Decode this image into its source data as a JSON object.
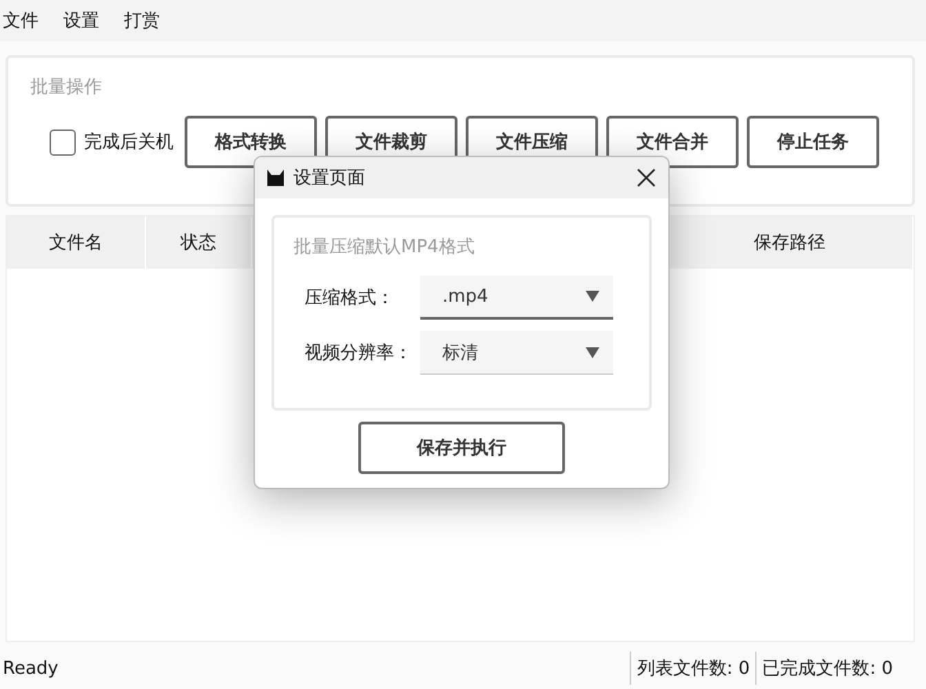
{
  "menu": [
    "文件",
    "设置",
    "打赏"
  ],
  "batch": {
    "title": "批量操作",
    "shutdown": {
      "label": "完成后关机",
      "checked": false
    },
    "buttons": [
      "格式转换",
      "文件裁剪",
      "文件压缩",
      "文件合并",
      "停止任务"
    ]
  },
  "table": {
    "columns": [
      {
        "label": "文件名"
      },
      {
        "label": "状态"
      },
      {
        "label": "保存路径"
      }
    ]
  },
  "status_bar": {
    "message": "Ready",
    "list_count": "列表文件数: 0",
    "done_count": "已完成文件数: 0"
  },
  "dialog": {
    "title": "设置页面",
    "group_title": "批量压缩默认MP4格式",
    "fields": [
      {
        "label": "压缩格式：",
        "value": ".mp4",
        "focused": true
      },
      {
        "label": "视频分辨率：",
        "value": "标清",
        "focused": false
      }
    ],
    "button": "保存并执行"
  }
}
